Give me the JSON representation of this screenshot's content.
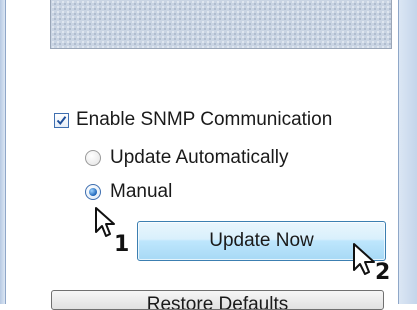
{
  "snmp": {
    "enable_label": "Enable SNMP Communication",
    "enable_checked": true,
    "options": [
      {
        "label": "Update Automatically",
        "selected": false
      },
      {
        "label": "Manual",
        "selected": true
      }
    ]
  },
  "buttons": {
    "update_now": "Update Now",
    "restore_defaults": "Restore Defaults"
  },
  "callouts": {
    "step1": "1",
    "step2": "2"
  },
  "colors": {
    "accent": "#3c7fb1",
    "radio_dot": "#1a63b8"
  }
}
